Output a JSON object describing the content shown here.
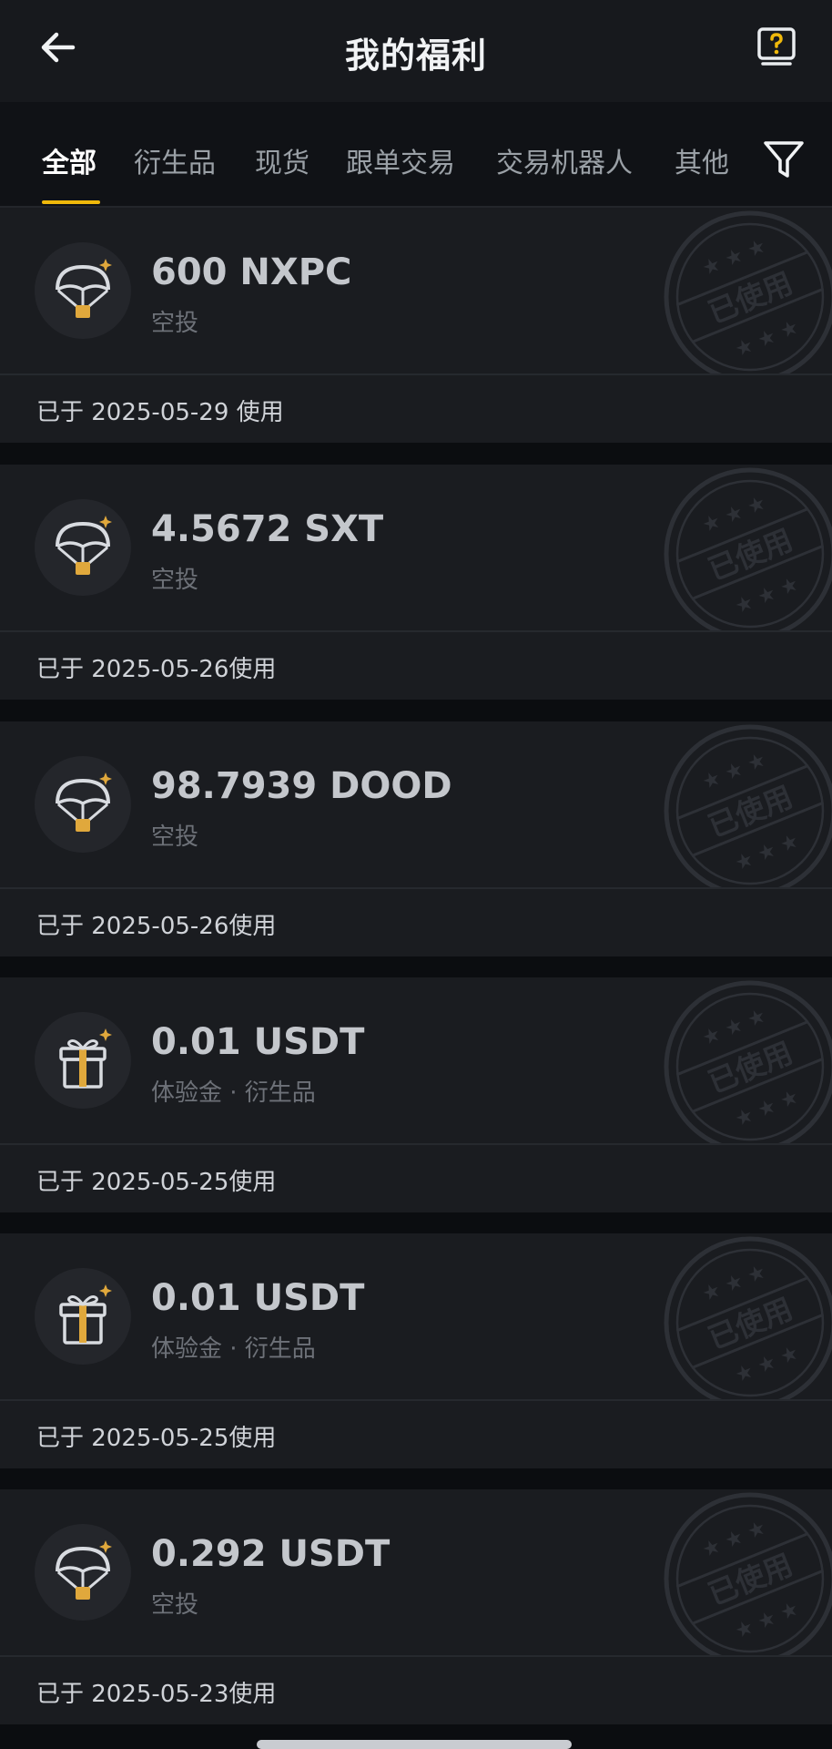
{
  "header": {
    "title": "我的福利",
    "back_icon": "arrow-left-icon",
    "help_icon": "question-box-icon"
  },
  "tabs": [
    {
      "label": "全部",
      "active": true
    },
    {
      "label": "衍生品",
      "active": false
    },
    {
      "label": "现货",
      "active": false
    },
    {
      "label": "跟单交易",
      "active": false
    },
    {
      "label": "交易机器人",
      "active": false
    },
    {
      "label": "其他",
      "active": false
    }
  ],
  "filter_icon": "filter-funnel-icon",
  "accent_color": "#f0b90b",
  "stamp_text": "已使用",
  "rewards": [
    {
      "amount": "600 NXPC",
      "subtype": "空投",
      "used": "已于 2025-05-29 使用",
      "icon": "parachute-airdrop-icon"
    },
    {
      "amount": "4.5672 SXT",
      "subtype": "空投",
      "used": "已于 2025-05-26使用",
      "icon": "parachute-airdrop-icon"
    },
    {
      "amount": "98.7939 DOOD",
      "subtype": "空投",
      "used": "已于 2025-05-26使用",
      "icon": "parachute-airdrop-icon"
    },
    {
      "amount": "0.01 USDT",
      "subtype": "体验金 · 衍生品",
      "used": "已于 2025-05-25使用",
      "icon": "gift-box-icon"
    },
    {
      "amount": "0.01 USDT",
      "subtype": "体验金 · 衍生品",
      "used": "已于 2025-05-25使用",
      "icon": "gift-box-icon"
    },
    {
      "amount": "0.292 USDT",
      "subtype": "空投",
      "used": "已于 2025-05-23使用",
      "icon": "parachute-airdrop-icon"
    }
  ]
}
